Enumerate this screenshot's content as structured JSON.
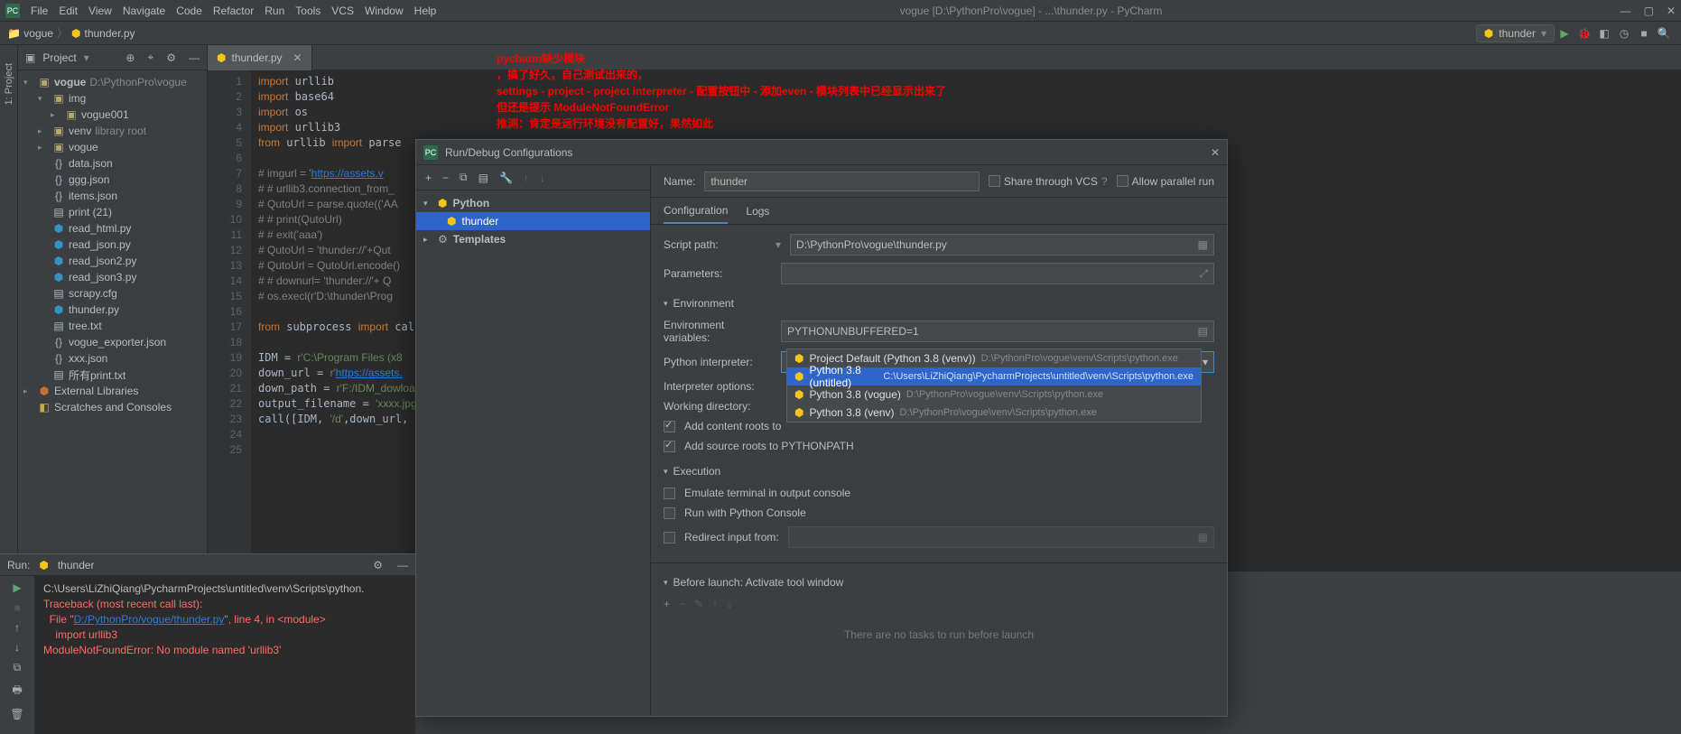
{
  "titlebar": {
    "menus": [
      "File",
      "Edit",
      "View",
      "Navigate",
      "Code",
      "Refactor",
      "Run",
      "Tools",
      "VCS",
      "Window",
      "Help"
    ],
    "title": "vogue [D:\\PythonPro\\vogue] - ...\\thunder.py - PyCharm"
  },
  "navbar": {
    "crumbs": [
      "vogue",
      "thunder.py"
    ],
    "run_config": "thunder"
  },
  "project": {
    "title": "Project",
    "root": "vogue",
    "root_path": "D:\\PythonPro\\vogue",
    "items": [
      {
        "name": "img",
        "type": "dir",
        "indent": 1,
        "expanded": true
      },
      {
        "name": "vogue001",
        "type": "dir",
        "indent": 2
      },
      {
        "name": "venv",
        "type": "dir",
        "indent": 1,
        "extra": "library root"
      },
      {
        "name": "vogue",
        "type": "dir",
        "indent": 1
      },
      {
        "name": "data.json",
        "type": "json",
        "indent": 1
      },
      {
        "name": "ggg.json",
        "type": "json",
        "indent": 1
      },
      {
        "name": "items.json",
        "type": "json",
        "indent": 1
      },
      {
        "name": "print (21)",
        "type": "txt",
        "indent": 1
      },
      {
        "name": "read_html.py",
        "type": "py",
        "indent": 1
      },
      {
        "name": "read_json.py",
        "type": "py",
        "indent": 1
      },
      {
        "name": "read_json2.py",
        "type": "py",
        "indent": 1
      },
      {
        "name": "read_json3.py",
        "type": "py",
        "indent": 1
      },
      {
        "name": "scrapy.cfg",
        "type": "txt",
        "indent": 1
      },
      {
        "name": "thunder.py",
        "type": "py",
        "indent": 1
      },
      {
        "name": "tree.txt",
        "type": "txt",
        "indent": 1
      },
      {
        "name": "vogue_exporter.json",
        "type": "json",
        "indent": 1
      },
      {
        "name": "xxx.json",
        "type": "json",
        "indent": 1
      },
      {
        "name": "所有print.txt",
        "type": "txt",
        "indent": 1
      }
    ],
    "ext_lib": "External Libraries",
    "scratches": "Scratches and Consoles"
  },
  "editor": {
    "tab": "thunder.py",
    "lines": [
      "1",
      "2",
      "3",
      "4",
      "5",
      "6",
      "7",
      "8",
      "9",
      "10",
      "11",
      "12",
      "13",
      "14",
      "15",
      "16",
      "17",
      "18",
      "19",
      "20",
      "21",
      "22",
      "23",
      "24",
      "25"
    ]
  },
  "annotation": {
    "l1": "pycharm缺少模块",
    "l2": " ，搞了好久，自己测试出来的，",
    "l3": "settings  -  project  -  project interpreter  -  配置按钮中  -  添加even  -  模块列表中已经显示出来了",
    "l4": "但还是提示 ModuleNotFoundError",
    "l5": "",
    "l6": "推测：肯定是运行环境没有配置好，果然如此"
  },
  "dialog": {
    "title": "Run/Debug Configurations",
    "left": {
      "python": "Python",
      "config": "thunder",
      "templates": "Templates"
    },
    "name_label": "Name:",
    "name_value": "thunder",
    "share_vcs": "Share through VCS",
    "allow_parallel": "Allow parallel run",
    "tabs": {
      "config": "Configuration",
      "logs": "Logs"
    },
    "script_path_label": "Script path:",
    "script_path_value": "D:\\PythonPro\\vogue\\thunder.py",
    "params_label": "Parameters:",
    "env_section": "Environment",
    "env_vars_label": "Environment variables:",
    "env_vars_value": "PYTHONUNBUFFERED=1",
    "interpreter_label": "Python interpreter:",
    "interpreter_value": "Python 3.8 (untitled)",
    "interpreter_value_path": "C:\\Users\\LiZhiQiang\\PycharmProjects\\untitled\\venv\\Scripts\\python.ex",
    "interp_opts_label": "Interpreter options:",
    "workdir_label": "Working directory:",
    "add_content": "Add content roots to",
    "add_source": "Add source roots to PYTHONPATH",
    "exec_section": "Execution",
    "emulate": "Emulate terminal in output console",
    "run_console": "Run with Python Console",
    "redirect": "Redirect input from:",
    "before_section": "Before launch: Activate tool window",
    "no_tasks": "There are no tasks to run before launch"
  },
  "dropdown": {
    "items": [
      {
        "name": "Project Default (Python 3.8 (venv))",
        "path": "D:\\PythonPro\\vogue\\venv\\Scripts\\python.exe",
        "sel": false
      },
      {
        "name": "Python 3.8 (untitled)",
        "path": "C:\\Users\\LiZhiQiang\\PycharmProjects\\untitled\\venv\\Scripts\\python.exe",
        "sel": true
      },
      {
        "name": "Python 3.8 (vogue)",
        "path": "D:\\PythonPro\\vogue\\venv\\Scripts\\python.exe",
        "sel": false
      },
      {
        "name": "Python 3.8 (venv)",
        "path": "D:\\PythonPro\\vogue\\venv\\Scripts\\python.exe",
        "sel": false
      }
    ]
  },
  "run": {
    "title": "Run:",
    "config": "thunder",
    "line1": "C:\\Users\\LiZhiQiang\\PycharmProjects\\untitled\\venv\\Scripts\\python.",
    "trace": "Traceback (most recent call last):",
    "file_pre": "  File \"",
    "file_link": "D:/PythonPro/vogue/thunder.py",
    "file_post": "\", line 4, in <module>",
    "import_line": "    import urllib3",
    "err": "ModuleNotFoundError: No module named 'urllib3'"
  }
}
